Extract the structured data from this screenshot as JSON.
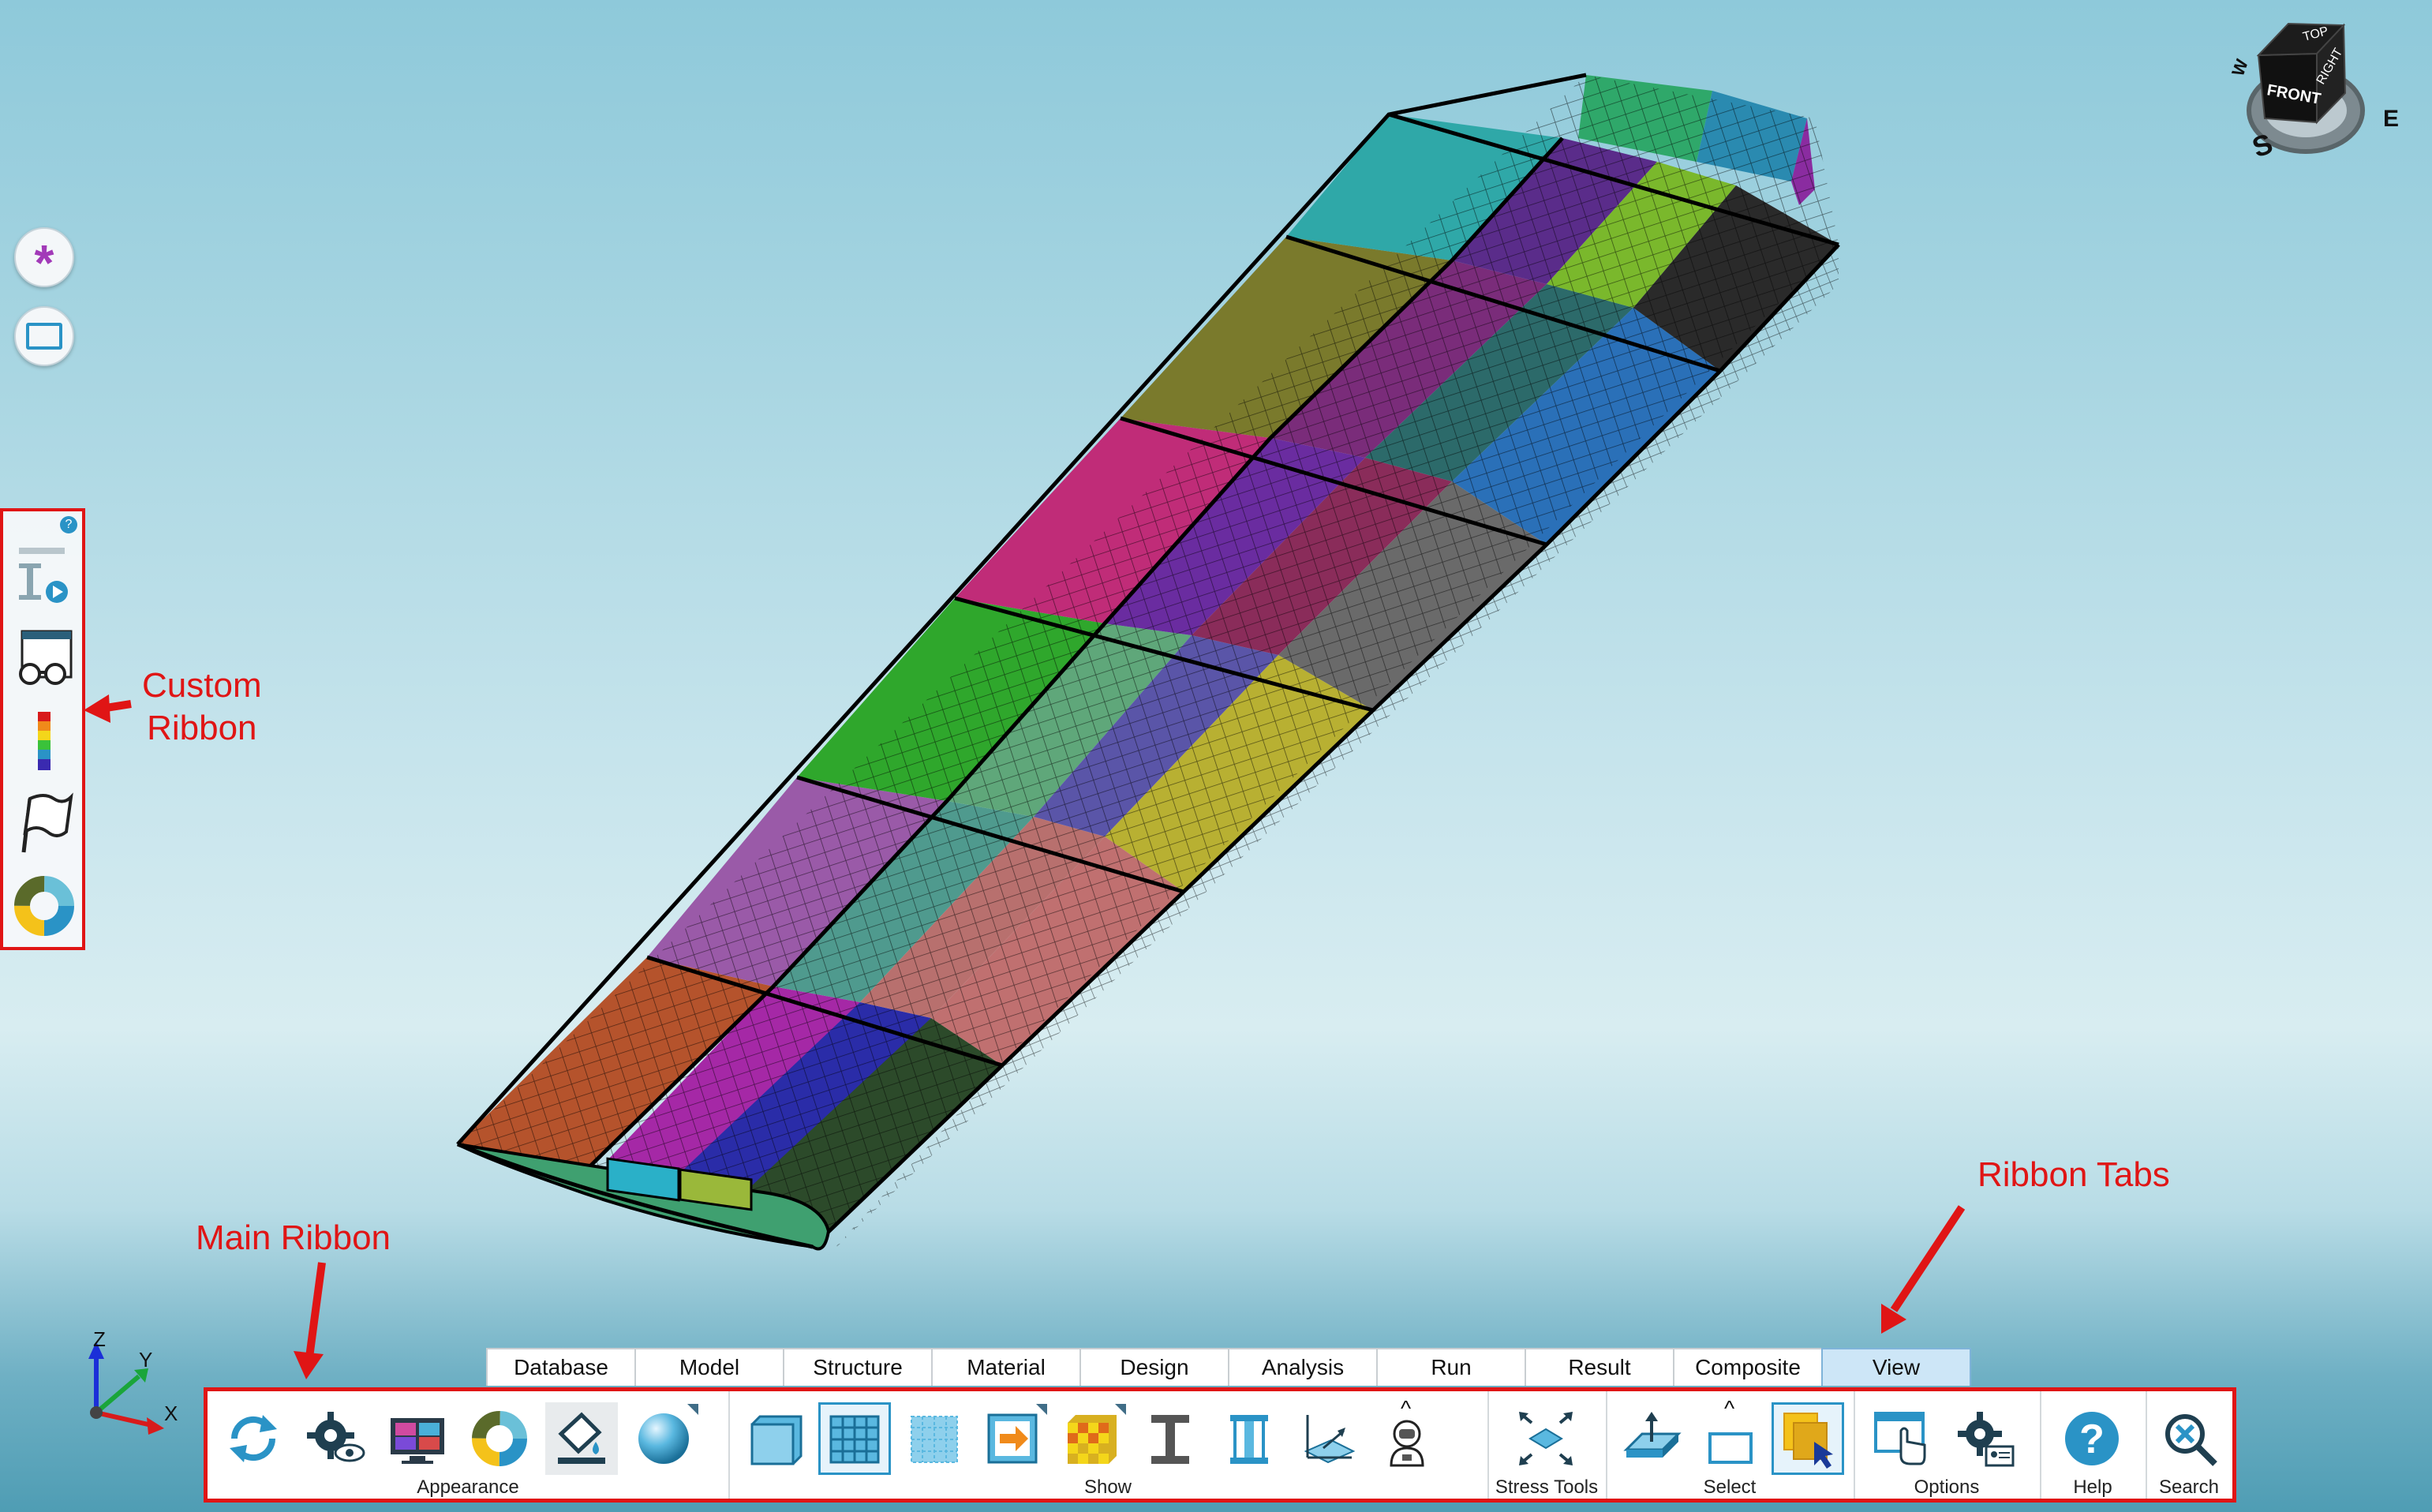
{
  "annotations": {
    "custom_ribbon": "Custom\nRibbon",
    "main_ribbon": "Main Ribbon",
    "ribbon_tabs": "Ribbon Tabs"
  },
  "view_cube": {
    "top": "TOP",
    "front": "FRONT",
    "right": "RIGHT",
    "compass_s": "S",
    "compass_e": "E",
    "compass_w": "W"
  },
  "axes": {
    "x": "X",
    "y": "Y",
    "z": "Z"
  },
  "side_buttons": [
    {
      "icon": "asterisk-icon"
    },
    {
      "icon": "rectangle-icon"
    }
  ],
  "custom_ribbon": {
    "help_badge": "?",
    "items": [
      {
        "icon": "beam-play-icon"
      },
      {
        "icon": "glasses-window-icon"
      },
      {
        "icon": "color-bar-icon"
      },
      {
        "icon": "flag-icon"
      },
      {
        "icon": "color-wheel-icon"
      }
    ]
  },
  "tabs": [
    "Database",
    "Model",
    "Structure",
    "Material",
    "Design",
    "Analysis",
    "Run",
    "Result",
    "Composite",
    "View"
  ],
  "active_tab": "View",
  "ribbon": {
    "groups": [
      {
        "label": "Appearance",
        "items": [
          "refresh-icon",
          "view-settings-icon",
          "display-monitor-icon",
          "color-ring-icon",
          "fill-bucket-icon",
          "sphere-icon"
        ]
      },
      {
        "label": "Show",
        "items": [
          "panel-icon",
          "mesh-grid-icon",
          "dotted-mesh-icon",
          "arrow-panel-icon",
          "checker-panel-icon",
          "i-beam-icon",
          "i-beam-blue-icon",
          "plane-axis-icon",
          "astronaut-icon"
        ]
      },
      {
        "label": "Stress Tools",
        "items": [
          "stress-tools-icon"
        ]
      },
      {
        "label": "Select",
        "items": [
          "select-plane-icon",
          "select-rect-icon",
          "select-layers-icon"
        ]
      },
      {
        "label": "Options",
        "items": [
          "window-pointer-icon",
          "options-gear-icon"
        ]
      },
      {
        "label": "Help",
        "items": [
          "help-icon"
        ]
      },
      {
        "label": "Search",
        "items": [
          "search-icon"
        ]
      }
    ]
  },
  "colors": {
    "annotation_red": "#e01515",
    "accent_blue": "#2a93c6",
    "tab_active_bg": "#cde6f7"
  }
}
